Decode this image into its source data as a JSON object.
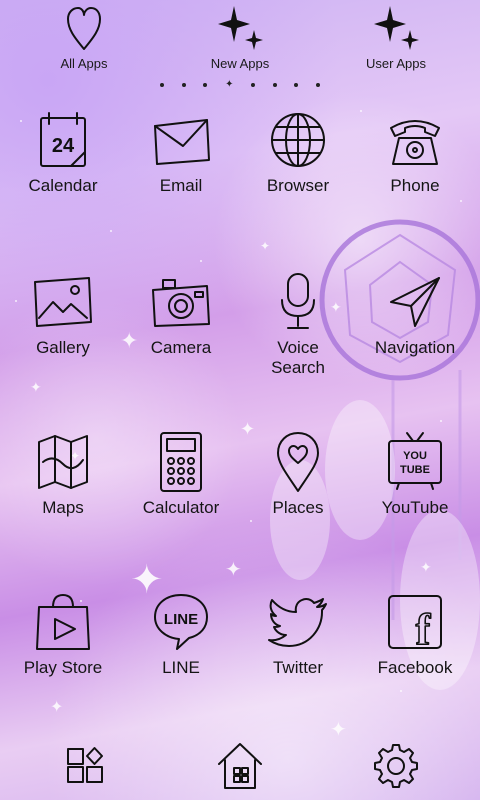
{
  "tabs": [
    {
      "label": "All Apps",
      "icon": "heart-icon"
    },
    {
      "label": "New Apps",
      "icon": "sparkle-icon"
    },
    {
      "label": "User Apps",
      "icon": "sparkle-icon"
    }
  ],
  "page_indicator": {
    "count": 8,
    "active_index": 3
  },
  "apps": [
    {
      "label": "Calendar",
      "icon": "calendar-icon",
      "calendar_day": "24"
    },
    {
      "label": "Email",
      "icon": "envelope-icon"
    },
    {
      "label": "Browser",
      "icon": "globe-icon"
    },
    {
      "label": "Phone",
      "icon": "telephone-icon"
    },
    {
      "label": "Gallery",
      "icon": "picture-icon"
    },
    {
      "label": "Camera",
      "icon": "camera-icon"
    },
    {
      "label": "Voice Search",
      "icon": "microphone-icon"
    },
    {
      "label": "Navigation",
      "icon": "paper-plane-icon"
    },
    {
      "label": "Maps",
      "icon": "map-icon"
    },
    {
      "label": "Calculator",
      "icon": "calculator-icon"
    },
    {
      "label": "Places",
      "icon": "map-pin-icon"
    },
    {
      "label": "YouTube",
      "icon": "tv-icon",
      "tv_text_1": "YOU",
      "tv_text_2": "TUBE"
    },
    {
      "label": "Play Store",
      "icon": "shopping-bag-icon"
    },
    {
      "label": "LINE",
      "icon": "speech-bubble-icon",
      "bubble_text": "LINE"
    },
    {
      "label": "Twitter",
      "icon": "bird-icon"
    },
    {
      "label": "Facebook",
      "icon": "facebook-icon",
      "fb_letter": "f"
    }
  ],
  "dock": [
    {
      "icon": "app-drawer-icon"
    },
    {
      "icon": "home-icon"
    },
    {
      "icon": "settings-gear-icon"
    }
  ]
}
